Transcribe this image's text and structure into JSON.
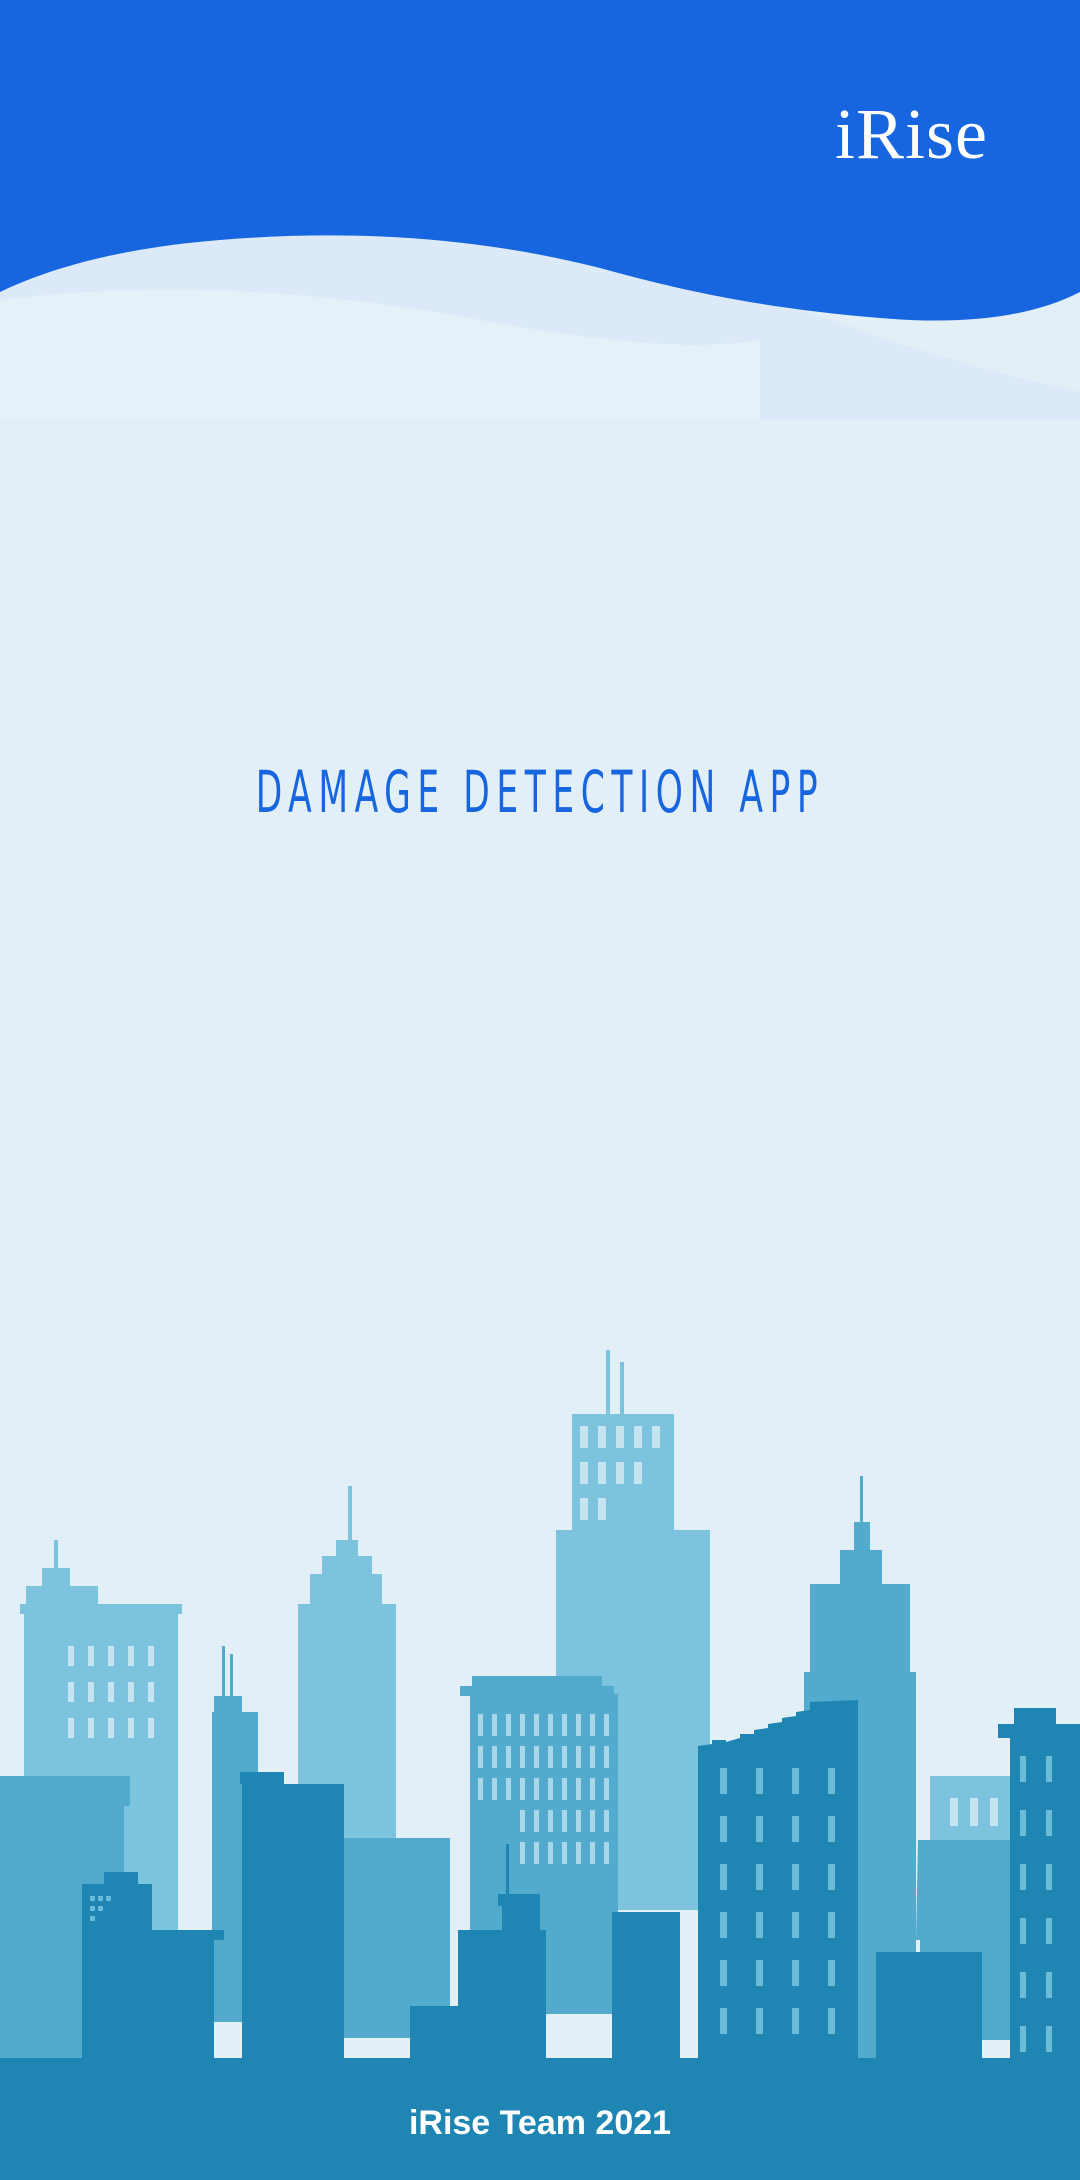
{
  "brand": {
    "logo_text": "iRise"
  },
  "splash": {
    "title": "DAMAGE DETECTION APP"
  },
  "footer": {
    "credit": "iRise Team 2021"
  },
  "colors": {
    "header_blue": "#1766e0",
    "background": "#e3eff7",
    "building_light": "#7cc3dd",
    "building_mid": "#52aacd",
    "building_dark": "#1f86b4"
  }
}
